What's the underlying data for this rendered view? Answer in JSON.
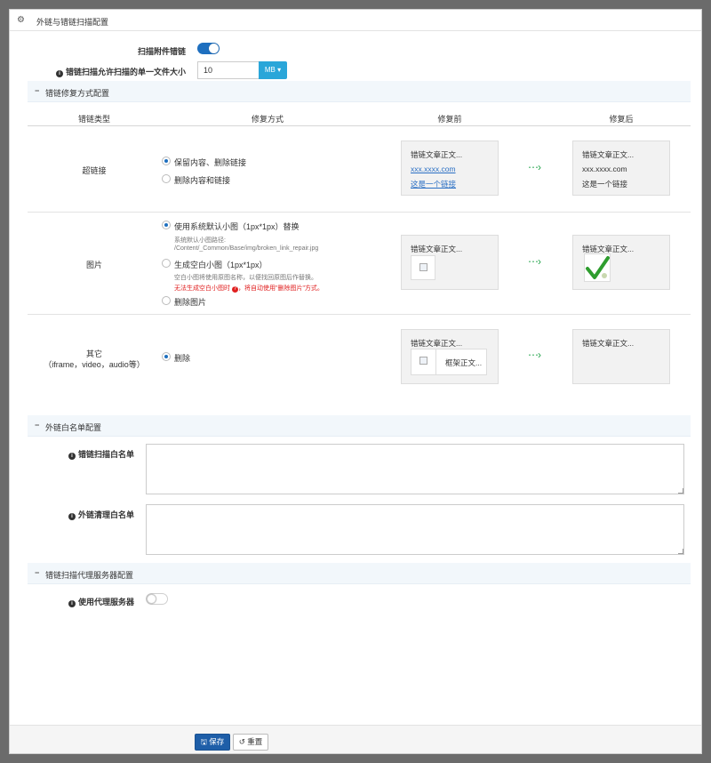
{
  "header": {
    "icon": "gear-icon",
    "title": "外链与错链扫描配置"
  },
  "top_form": {
    "scan_attachment_label": "扫描附件错链",
    "scan_attachment_enabled": true,
    "max_size_label": "错链扫描允许扫描的单一文件大小",
    "max_size_value": "10",
    "unit_label": "MB"
  },
  "repair_section": {
    "title": "错链修复方式配置",
    "columns": [
      "错链类型",
      "修复方式",
      "修复前",
      "修复后"
    ],
    "rows": [
      {
        "type": "超链接",
        "options": [
          "保留内容、删除链接",
          "删除内容和链接"
        ],
        "selected": 0,
        "before": {
          "title": "错链文章正文...",
          "link1": "xxx.xxxx.com",
          "link2": "这是一个链接"
        },
        "after": {
          "title": "错链文章正文...",
          "line1": "xxx.xxxx.com",
          "line2": "这是一个链接"
        }
      },
      {
        "type": "图片",
        "options": [
          "使用系统默认小图（1px*1px）替换",
          "生成空白小图（1px*1px）",
          "删除图片"
        ],
        "selected": 0,
        "hint1_label": "系统默认小图路径:",
        "hint1_path": "/Content/_Common/Base/img/broken_link_repair.jpg",
        "hint2": "空白小图将使用原图名称，以便找回原图后作替换。",
        "hint2_red": "无法生成空白小图时",
        "hint2_red_tail": "，将自动使用\"删除图片\"方式。",
        "before": {
          "title": "错链文章正文..."
        },
        "after": {
          "title": "错链文章正文..."
        }
      },
      {
        "type": "其它",
        "type_sub": "（iframe，video，audio等）",
        "options": [
          "删除"
        ],
        "selected": 0,
        "before": {
          "title": "错链文章正文...",
          "frame_text": "框架正文..."
        },
        "after": {
          "title": "错链文章正文..."
        }
      }
    ]
  },
  "whitelist_section": {
    "title": "外链白名单配置",
    "scan_whitelist_label": "错链扫描白名单",
    "scan_whitelist_value": "",
    "clean_whitelist_label": "外链清理白名单",
    "clean_whitelist_value": ""
  },
  "proxy_section": {
    "title": "错链扫描代理服务器配置",
    "use_proxy_label": "使用代理服务器",
    "use_proxy_enabled": false
  },
  "footer": {
    "save_label": "保存",
    "reset_label": "重置"
  },
  "colors": {
    "primary": "#1e5ea8",
    "toggle_on": "#1e6fbf",
    "unit_button": "#2aa6d9",
    "arrow": "#22a34a",
    "warning": "#e02020",
    "link": "#2a6fc4"
  }
}
